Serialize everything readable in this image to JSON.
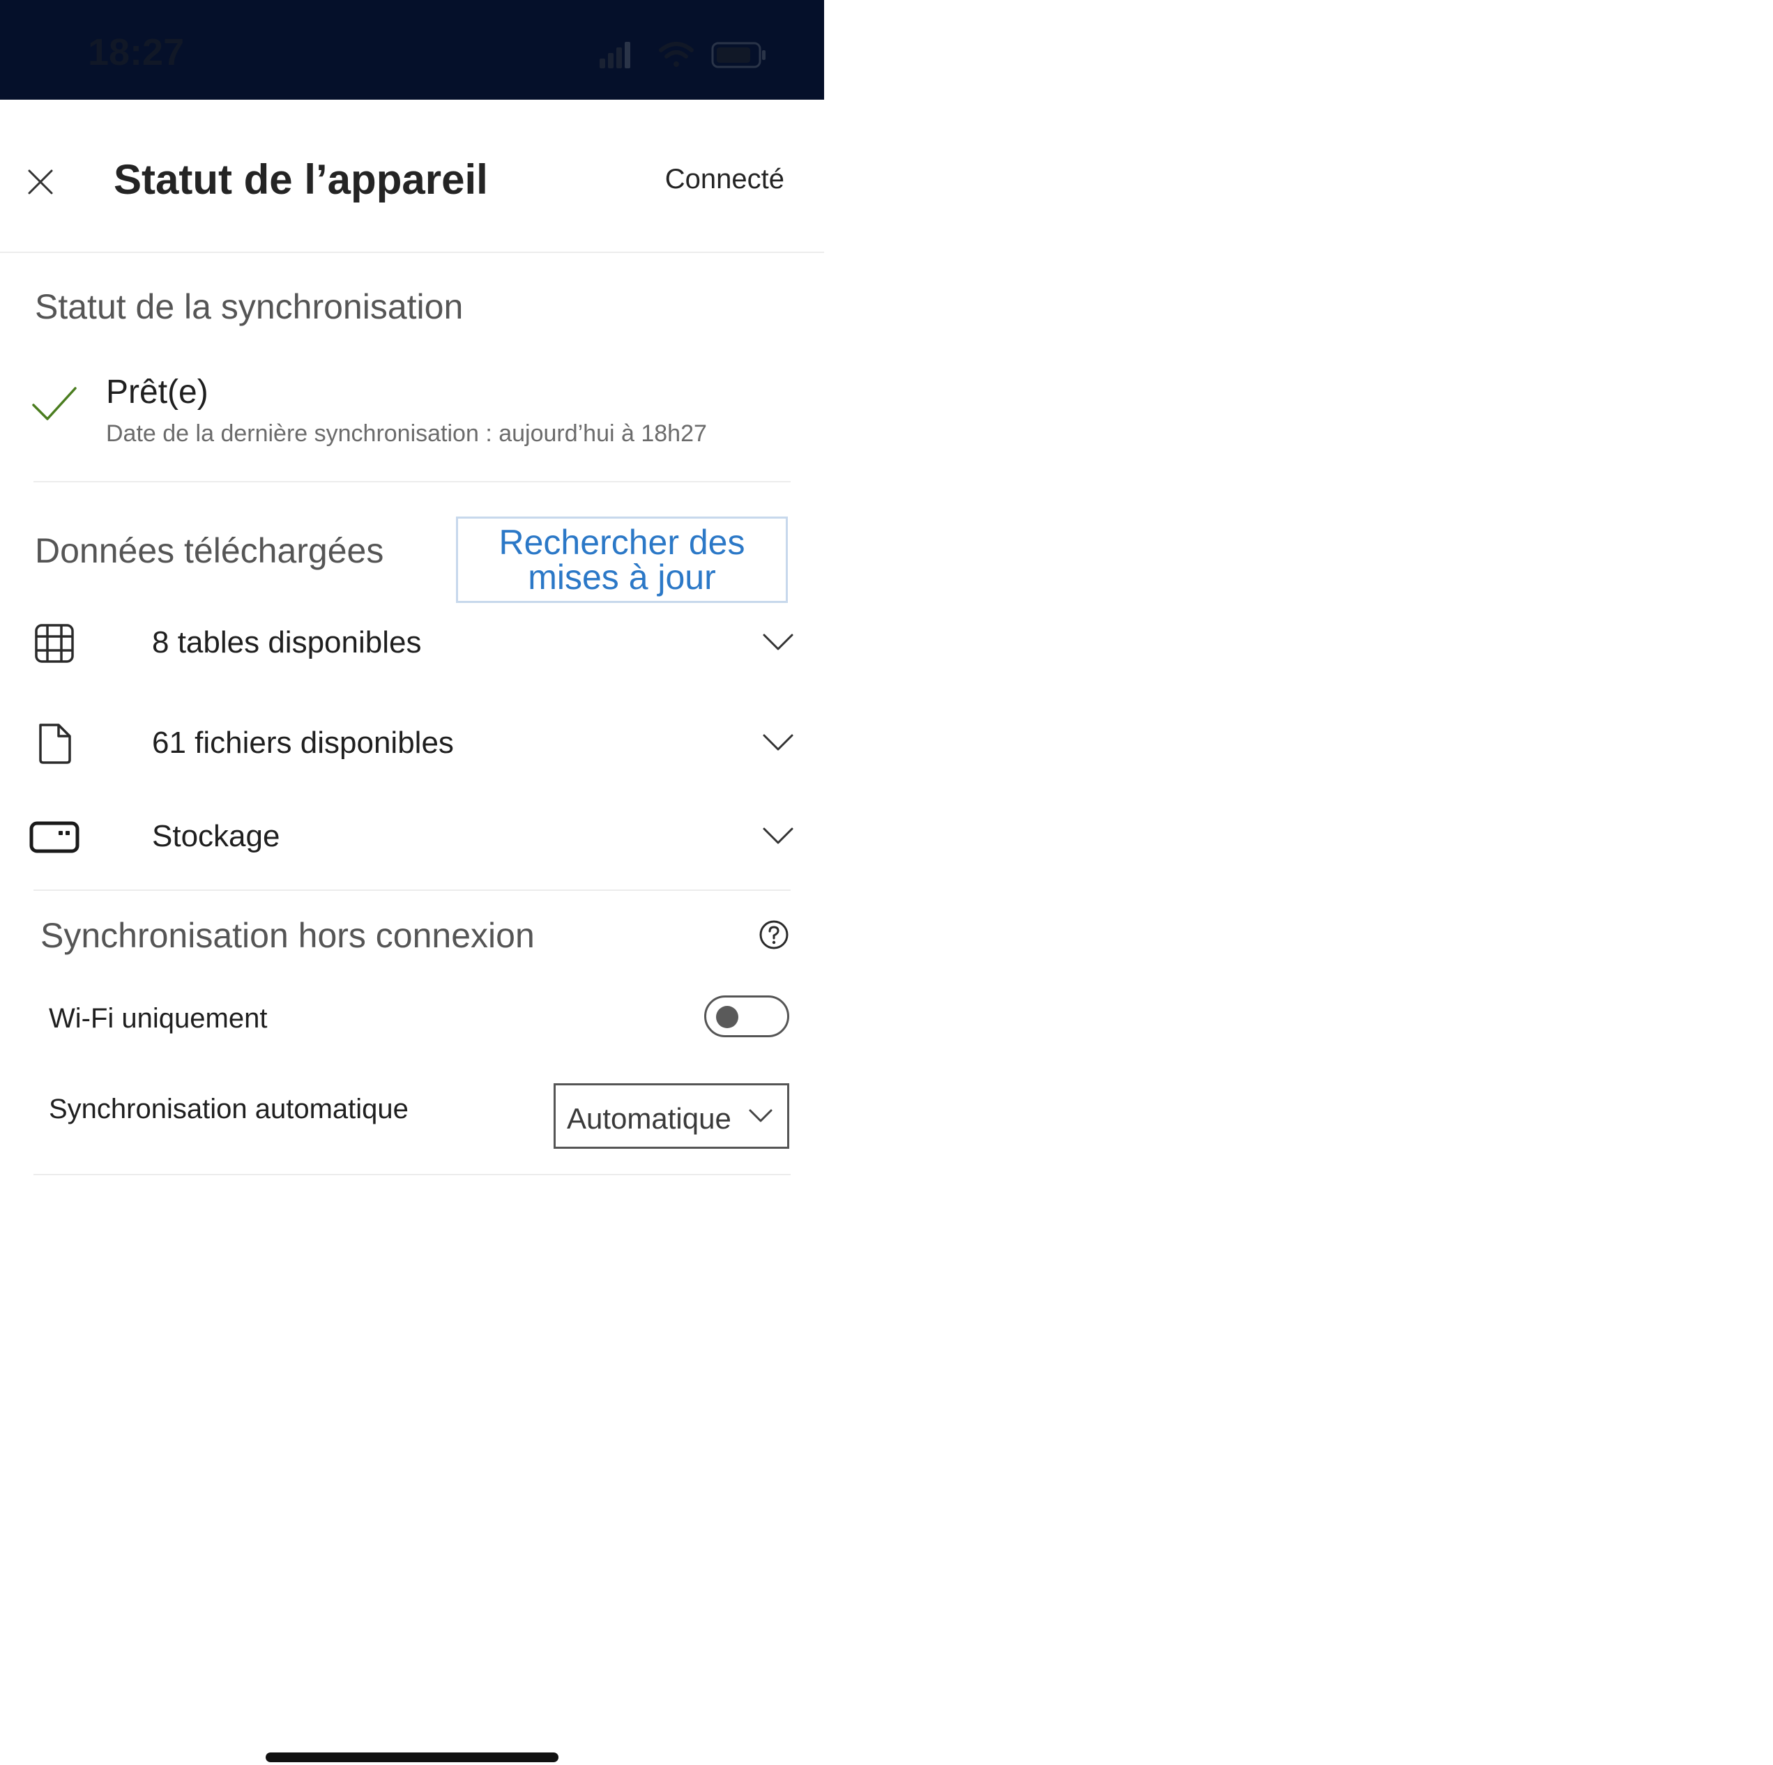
{
  "status_bar": {
    "time": "18:27",
    "signal_icon": "cellular-signal-icon",
    "wifi_icon": "wifi-icon",
    "battery_icon": "battery-icon",
    "background": "#05102a"
  },
  "header": {
    "close_icon": "close-icon",
    "title": "Statut de l’appareil",
    "connection_status": "Connecté"
  },
  "sync_status": {
    "section_title": "Statut de la synchronisation",
    "state_icon": "check-icon",
    "state_label": "Prêt(e)",
    "last_sync": "Date de la dernière synchronisation : aujourd’hui à 18h27",
    "check_color": "#4a7d1f"
  },
  "downloaded": {
    "section_title": "Données téléchargées",
    "refresh_button": "Rechercher des mises à jour",
    "rows": [
      {
        "icon": "table-icon",
        "label": "8 tables disponibles"
      },
      {
        "icon": "file-icon",
        "label": "61 fichiers disponibles"
      },
      {
        "icon": "storage-icon",
        "label": "Stockage"
      }
    ]
  },
  "offline_sync": {
    "section_title": "Synchronisation hors connexion",
    "help_icon": "help-icon",
    "wifi_only": {
      "label": "Wi-Fi uniquement",
      "enabled": false
    },
    "auto_sync": {
      "label": "Synchronisation automatique",
      "selected": "Automatique"
    }
  },
  "colors": {
    "accent": "#2b78c7",
    "button_border": "#c7d8ec",
    "divider": "#ececec"
  }
}
